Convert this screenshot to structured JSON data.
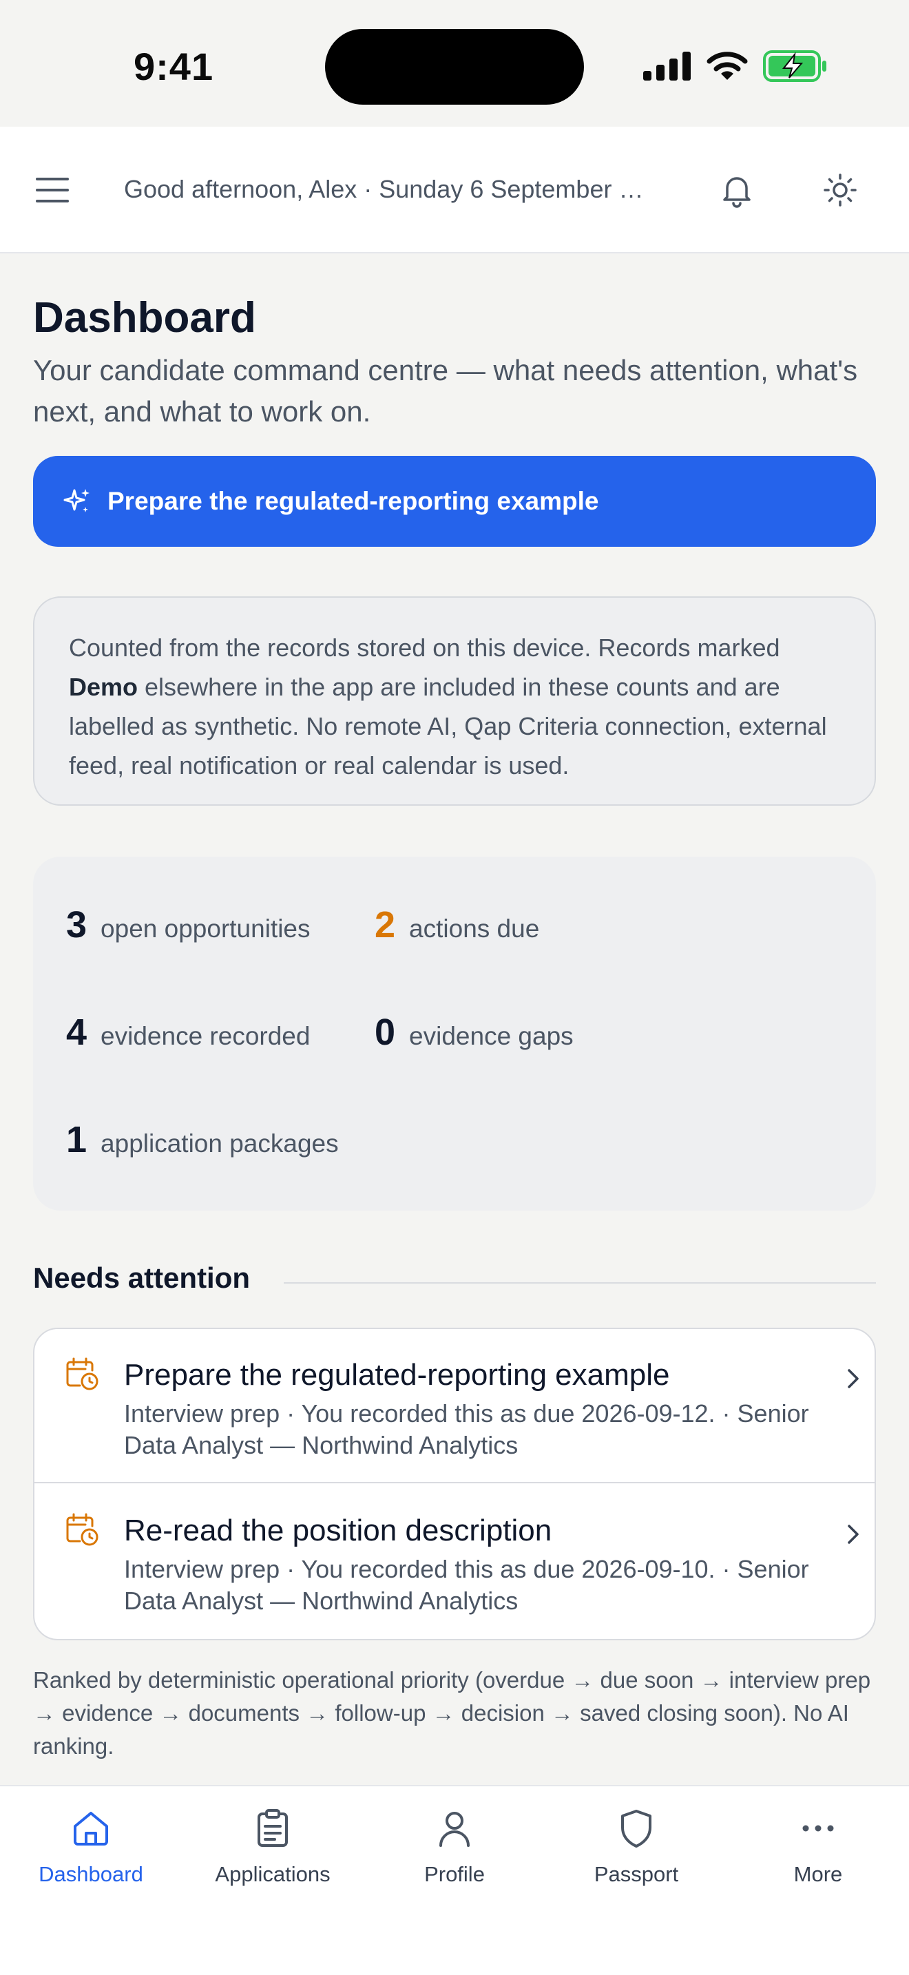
{
  "status_bar": {
    "time": "9:41"
  },
  "header": {
    "greeting": "Good afternoon, Alex · Sunday 6 September …"
  },
  "page": {
    "title": "Dashboard",
    "subtitle": "Your candidate command centre — what needs attention, what's next, and what to work on.",
    "primary_action_label": "Prepare the regulated-reporting example"
  },
  "info_note": {
    "part1": "Counted from the records stored on this device. Records marked ",
    "bold": "Demo",
    "part2": " elsewhere in the app are included in these counts and are labelled as synthetic. No remote AI, Qap Criteria connection, external feed, real notification or real calendar is used."
  },
  "stats": [
    {
      "value": "3",
      "label": "open opportunities"
    },
    {
      "value": "2",
      "label": "actions due"
    },
    {
      "value": "4",
      "label": "evidence recorded"
    },
    {
      "value": "0",
      "label": "evidence gaps"
    },
    {
      "value": "1",
      "label": "application packages"
    }
  ],
  "needs_attention": {
    "heading": "Needs attention",
    "items": [
      {
        "title": "Prepare the regulated-reporting example",
        "meta": "Interview prep · You recorded this as due 2026-09-12. · Senior Data Analyst — Northwind Analytics"
      },
      {
        "title": "Re-read the position description",
        "meta": "Interview prep · You recorded this as due 2026-09-10. · Senior Data Analyst — Northwind Analytics"
      }
    ],
    "footnote": "Ranked by deterministic operational priority (overdue → due soon → interview prep → evidence → documents → follow-up → decision → saved closing soon). No AI ranking."
  },
  "tabs": [
    {
      "label": "Dashboard",
      "icon": "home-icon",
      "active": true
    },
    {
      "label": "Applications",
      "icon": "clipboard-icon",
      "active": false
    },
    {
      "label": "Profile",
      "icon": "person-icon",
      "active": false
    },
    {
      "label": "Passport",
      "icon": "shield-icon",
      "active": false
    },
    {
      "label": "More",
      "icon": "more-icon",
      "active": false
    }
  ],
  "colors": {
    "accent": "#2563eb",
    "warning": "#d97706",
    "battery": "#34c759"
  }
}
